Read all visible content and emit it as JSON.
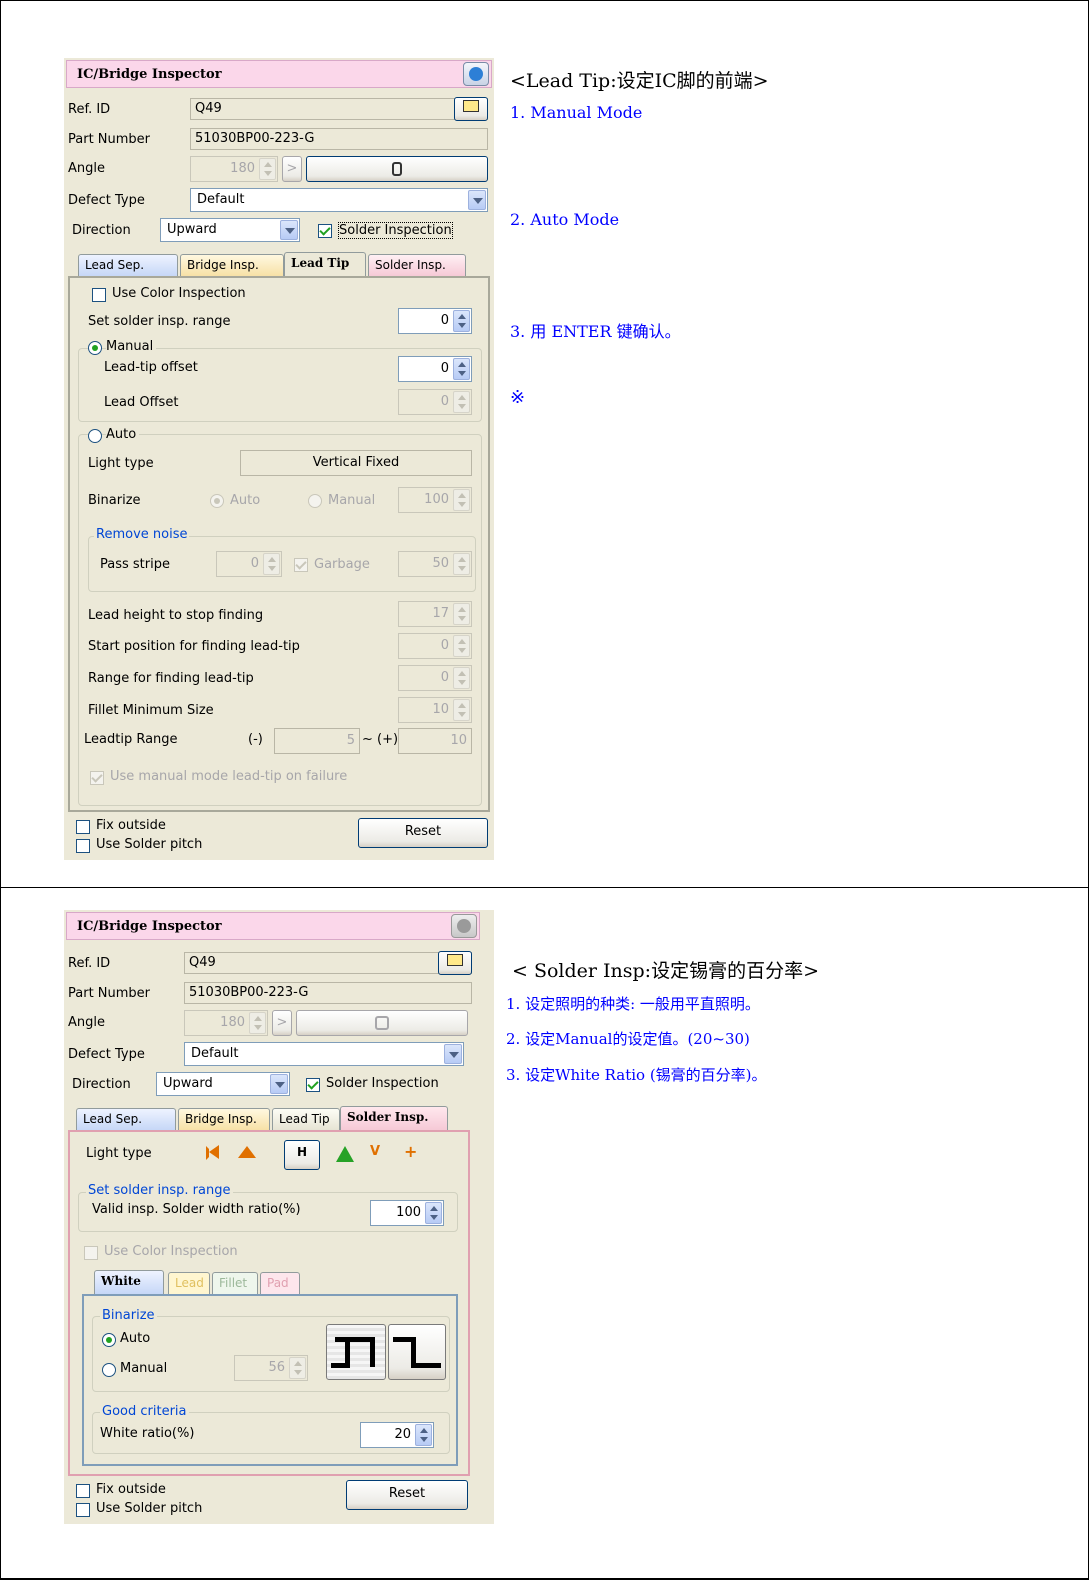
{
  "panel1": {
    "title": "IC/Bridge Inspector",
    "ref_id_label": "Ref. ID",
    "ref_id": "Q49",
    "part_number_label": "Part Number",
    "part_number": "51030BP00-223-G",
    "angle_label": "Angle",
    "angle": "180",
    "angle_go": ">",
    "defect_type_label": "Defect Type",
    "defect_type": "Default",
    "direction_label": "Direction",
    "direction": "Upward",
    "solder_inspection": "Solder Inspection",
    "tabs": [
      "Lead Sep.",
      "Bridge Insp.",
      "Lead Tip",
      "Solder Insp."
    ],
    "use_color": "Use Color Inspection",
    "set_solder_range": "Set solder insp. range",
    "set_solder_range_val": "0",
    "manual": "Manual",
    "lead_tip_offset": "Lead-tip offset",
    "lead_tip_offset_val": "0",
    "lead_offset": "Lead Offset",
    "lead_offset_val": "0",
    "auto": "Auto",
    "light_type": "Light type",
    "light_type_val": "Vertical Fixed",
    "binarize": "Binarize",
    "bin_auto": "Auto",
    "bin_manual": "Manual",
    "bin_val": "100",
    "remove_noise": "Remove noise",
    "pass_stripe": "Pass stripe",
    "pass_stripe_val": "0",
    "garbage": "Garbage",
    "garbage_val": "50",
    "lead_height": "Lead height to stop finding",
    "lead_height_val": "17",
    "start_pos": "Start position for finding lead-tip",
    "start_pos_val": "0",
    "range_find": "Range for finding lead-tip",
    "range_find_val": "0",
    "fillet_min": "Fillet Minimum Size",
    "fillet_min_val": "10",
    "leadtip_range": "Leadtip Range",
    "minus": "(-)",
    "leadtip_min": "5",
    "plus": "~ (+)",
    "leadtip_max": "10",
    "use_manual_failure": "Use manual mode lead-tip on  failure",
    "fix_outside": "Fix outside",
    "use_solder_pitch": "Use Solder pitch",
    "reset": "Reset"
  },
  "panel2": {
    "title": "IC/Bridge Inspector",
    "ref_id_label": "Ref. ID",
    "ref_id": "Q49",
    "part_number_label": "Part Number",
    "part_number": "51030BP00-223-G",
    "angle_label": "Angle",
    "angle": "180",
    "angle_go": ">",
    "defect_type_label": "Defect Type",
    "defect_type": "Default",
    "direction_label": "Direction",
    "direction": "Upward",
    "solder_inspection": "Solder Inspection",
    "tabs": [
      "Lead Sep.",
      "Bridge Insp.",
      "Lead Tip",
      "Solder Insp."
    ],
    "light_type": "Light type",
    "light_h": "H",
    "light_v": "V",
    "light_plus": "+",
    "set_solder_range": "Set solder insp. range",
    "valid_width": "Valid insp. Solder width ratio(%)",
    "valid_width_val": "100",
    "use_color": "Use Color Inspection",
    "subtabs": [
      "White",
      "Lead",
      "Fillet",
      "Pad"
    ],
    "binarize": "Binarize",
    "auto": "Auto",
    "manual": "Manual",
    "manual_val": "56",
    "good_criteria": "Good criteria",
    "white_ratio": "White ratio(%)",
    "white_ratio_val": "20",
    "fix_outside": "Fix outside",
    "use_solder_pitch": "Use Solder pitch",
    "reset": "Reset"
  },
  "notes1": {
    "title": "<Lead  Tip:设定IC脚的前端>",
    "item1": "1. Manual  Mode",
    "item2": "2. Auto  Mode",
    "item3": "3. 用  ENTER  键确认。",
    "mark": "※"
  },
  "notes2": {
    "title": "< Solder  Insp:设定锡膏的百分率>",
    "item1": "1.   设定照明的种类: 一般用平直照明。",
    "item2": "2.   设定Manual的设定值。(20~30)",
    "item3": "3.   设定White  Ratio (锡膏的百分率)。"
  }
}
